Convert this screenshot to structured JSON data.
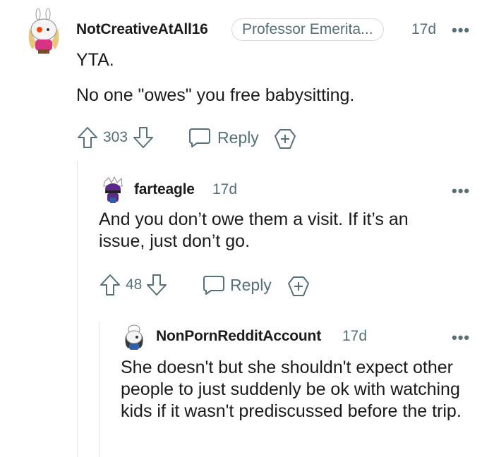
{
  "comments": [
    {
      "username": "NotCreativeAtAll16",
      "flair": "Professor Emerita...",
      "time": "17d",
      "more": "•••",
      "body": [
        "YTA.",
        "No one \"owes\" you free babysitting."
      ],
      "votes": "303",
      "reply_label": "Reply"
    },
    {
      "username": "farteagle",
      "time": "17d",
      "more": "•••",
      "body": [
        "And you don’t owe them a visit. If it’s an issue, just don’t go."
      ],
      "votes": "48",
      "reply_label": "Reply"
    },
    {
      "username": "NonPornRedditAccount",
      "time": "17d",
      "more": "•••",
      "body": [
        "She doesn't but she shouldn't expect other people to just suddenly be ok with watching kids if it wasn't prediscussed before the trip."
      ]
    }
  ],
  "colors": {
    "text": "#1a1a1b",
    "meta": "#576f76",
    "thread_line": "#e3e6e8",
    "avatar1_accent": "#d63384",
    "avatar2_accent": "#5b2a86",
    "avatar3_accent": "#2f5fa8"
  },
  "icons": [
    "upvote-icon",
    "downvote-icon",
    "comment-icon",
    "award-icon",
    "more-icon",
    "avatar"
  ]
}
